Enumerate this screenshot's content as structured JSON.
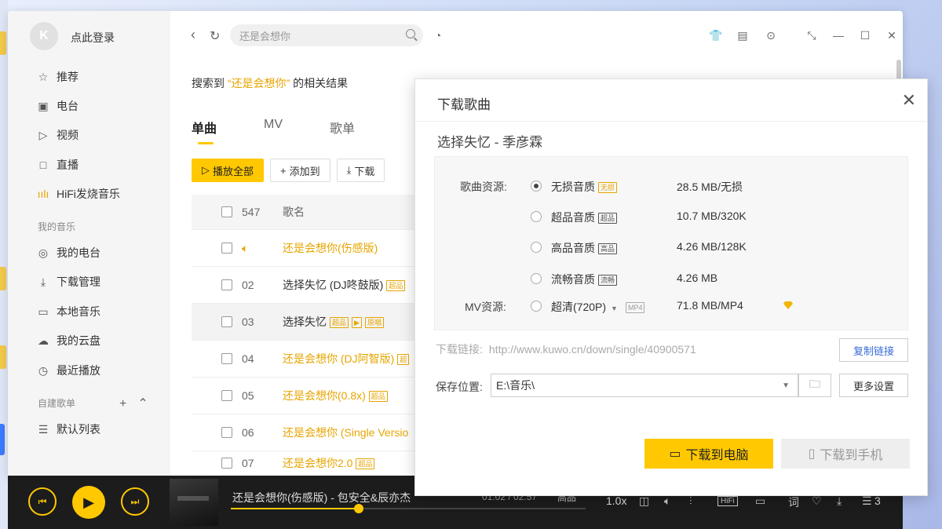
{
  "sidebar": {
    "login_text": "点此登录",
    "main_items": [
      {
        "label": "推荐",
        "icon": "star-icon"
      },
      {
        "label": "电台",
        "icon": "radio-icon"
      },
      {
        "label": "视频",
        "icon": "video-icon"
      },
      {
        "label": "直播",
        "icon": "live-icon"
      },
      {
        "label": "HiFi发烧音乐",
        "icon": "hifi-icon"
      }
    ],
    "my_music_title": "我的音乐",
    "my_music_items": [
      {
        "label": "我的电台",
        "icon": "location-icon"
      },
      {
        "label": "下载管理",
        "icon": "download-icon"
      },
      {
        "label": "本地音乐",
        "icon": "monitor-icon"
      },
      {
        "label": "我的云盘",
        "icon": "cloud-icon"
      },
      {
        "label": "最近播放",
        "icon": "clock-icon"
      }
    ],
    "playlist_title": "自建歌单",
    "playlist_items": [
      {
        "label": "默认列表",
        "icon": "list-icon"
      }
    ]
  },
  "topbar": {
    "search_value": "还是会想你"
  },
  "results": {
    "prefix": "搜索到",
    "open_quote": "“",
    "keyword": "还是会想你",
    "close_quote": "”",
    "suffix": "的相关结果"
  },
  "tabs": [
    {
      "label": "单曲"
    },
    {
      "label": "MV"
    },
    {
      "label": "歌单"
    }
  ],
  "actions": {
    "play_all": "播放全部",
    "add_to": "添加到",
    "download": "下载"
  },
  "table": {
    "count": "547",
    "header_title": "歌名",
    "rows": [
      {
        "num": "",
        "title": "还是会想你(伤感版)",
        "highlight": true,
        "badges": []
      },
      {
        "num": "02",
        "title": "选择失忆 (DJ咚鼓版)",
        "highlight": false,
        "badges": [
          "超品"
        ]
      },
      {
        "num": "03",
        "title": "选择失忆",
        "highlight": false,
        "badges": [
          "超品",
          "▶",
          "原唱"
        ]
      },
      {
        "num": "04",
        "title": "还是会想你 (DJ阿智版)",
        "highlight": true,
        "badges": [
          "超"
        ]
      },
      {
        "num": "05",
        "title": "还是会想你(0.8x)",
        "highlight": true,
        "badges": [
          "超品"
        ]
      },
      {
        "num": "06",
        "title": "还是会想你 (Single Versio",
        "highlight": true,
        "badges": []
      },
      {
        "num": "07",
        "title": "还是会想你2.0",
        "highlight": true,
        "badges": [
          "超品"
        ]
      }
    ]
  },
  "player": {
    "now_playing": "还是会想你(伤感版) - 包安全&辰亦杰",
    "time": "01:02 / 02:57",
    "quality": "高品",
    "progress": 0.36,
    "speed": "1.0x",
    "hifi": "HiFi",
    "lyric": "词",
    "queue_count": "3"
  },
  "dialog": {
    "title": "下载歌曲",
    "song": "选择失忆  - 季彦霖",
    "song_source_label": "歌曲资源:",
    "mv_source_label": "MV资源:",
    "options": [
      {
        "label": "无损音质",
        "badge": "无损",
        "badge_style": "gold",
        "size": "28.5 MB/无损",
        "selected": true
      },
      {
        "label": "超品音质",
        "badge": "超品",
        "badge_style": "dark",
        "size": "10.7 MB/320K",
        "selected": false
      },
      {
        "label": "高品音质",
        "badge": "高品",
        "badge_style": "dark",
        "size": "4.26 MB/128K",
        "selected": false
      },
      {
        "label": "流畅音质",
        "badge": "流畅",
        "badge_style": "dark",
        "size": "4.26 MB",
        "selected": false
      }
    ],
    "mv_option": {
      "label": "超清(720P)",
      "badge": "MP4",
      "size": "71.8 MB/MP4"
    },
    "link_label": "下载链接:",
    "link_url": "http://www.kuwo.cn/down/single/40900571",
    "copy_link": "复制链接",
    "save_label": "保存位置:",
    "save_path": "E:\\音乐\\",
    "more_settings": "更多设置",
    "download_pc": "下载到电脑",
    "download_phone": "下载到手机"
  },
  "colors": {
    "accent": "#ffc800",
    "highlight_text": "#e7a500",
    "player_bg": "#1c1c1c"
  }
}
